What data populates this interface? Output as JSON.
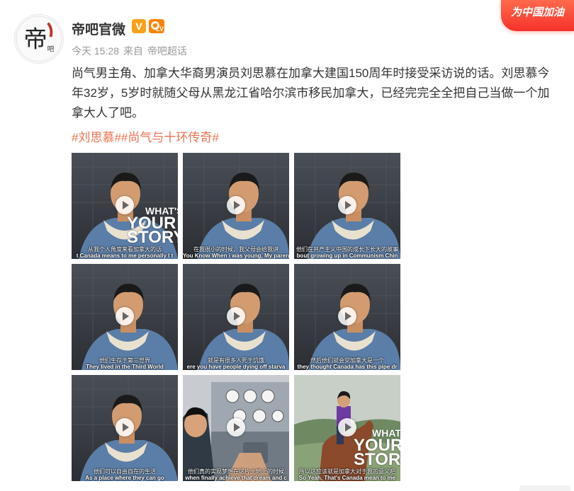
{
  "post": {
    "author": "帝吧官微",
    "verified_badge": "V",
    "level_badge": "LV",
    "time": "今天 15:28",
    "from_label": "来自",
    "source": "帝吧超话",
    "text": "尚气男主角、加拿大华裔男演员刘思慕在加拿大建国150周年时接受采访说的话。刘思慕今年32岁，5岁时就随父母从黑龙江省哈尔滨市移民加拿大，已经完完全全把自己当做一个加拿大人了吧。",
    "tags": [
      "#刘思慕#",
      "#尚气与十环传奇#"
    ],
    "avatar_char": "帝",
    "avatar_small": "吧"
  },
  "promo": {
    "label": "为中国加油"
  },
  "overlay": {
    "line1": "WHAT'S",
    "line2": "YOUR",
    "line3": "STORY"
  },
  "thumbnails": [
    {
      "zh": "从我个人角度来看加拿大的话",
      "en": "t Canada  means to me personally  I t",
      "scene": "studio",
      "overlay": true
    },
    {
      "zh": "在我很小的时候，我父母会给我讲",
      "en": "You Know When i was young, My parents was tell me this stories",
      "scene": "studio",
      "overlay": false
    },
    {
      "zh": "他们在共产主义中国的成长下长大的故事",
      "en": "bout growing up in Communism Chin",
      "scene": "studio",
      "overlay": false
    },
    {
      "zh": "他们生存于第三世界",
      "en": "They lived in the Third World",
      "scene": "studio",
      "overlay": false
    },
    {
      "zh": "就是有很多人死于饥饿",
      "en": "ere you have people dying off starva",
      "scene": "studio",
      "overlay": false
    },
    {
      "zh": "然后他们就会觉加拿大是一个",
      "en": "they thought Canada has this pipe dr",
      "scene": "studio",
      "overlay": false
    },
    {
      "zh": "他们可以自由自在的生活",
      "en": "As a place where they can go",
      "scene": "studio",
      "overlay": false
    },
    {
      "zh": "他们真的实现梦想在这片土地上的时候",
      "en": "when finally achieve that dream and c",
      "scene": "cockpit",
      "overlay": false
    },
    {
      "zh": "所以这应该就是加拿大对于我的意义吧",
      "en": "So Yeah, That's Canada mean to me",
      "scene": "horse",
      "overlay": true
    }
  ],
  "colors": {
    "tag": "#eb7350",
    "meta": "#999999",
    "text": "#333333",
    "promo": "#f6312c"
  }
}
